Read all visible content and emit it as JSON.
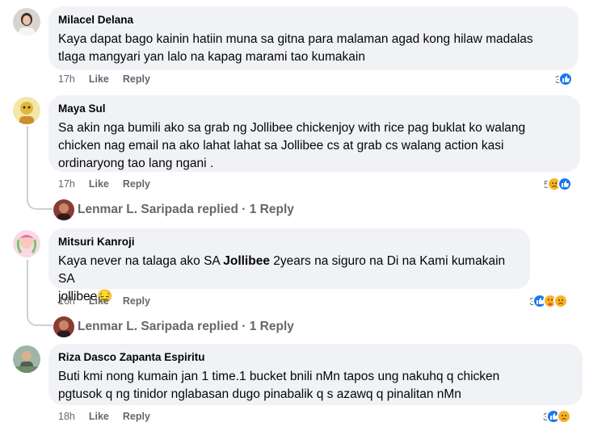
{
  "comments": [
    {
      "author": "Milacel Delana",
      "text": [
        "Kaya dapat bago kainin hatiin muna sa gitna para malaman agad kong hilaw madalas",
        "tlaga mangyari yan lalo na kapag marami tao kumakain"
      ],
      "time": "17h",
      "like_label": "Like",
      "reply_label": "Reply",
      "reaction_count": "3",
      "reaction_icons": [
        "like-icon"
      ]
    },
    {
      "author": "Maya Sul",
      "text": [
        "Sa akin nga bumili ako sa grab ng Jollibee chickenjoy with rice pag buklat ko walang",
        "chicken nag email na ako lahat lahat sa Jollibee cs at grab cs walang action kasi",
        "ordinaryong tao lang ngani ."
      ],
      "time": "17h",
      "like_label": "Like",
      "reply_label": "Reply",
      "reaction_count": "5",
      "reaction_icons": [
        "sad-icon",
        "like-icon"
      ],
      "replies_summary": "Lenmar L. Saripada replied · 1 Reply"
    },
    {
      "author": "Mitsuri Kanroji",
      "text_before": "Kaya never na talaga ako SA ",
      "text_bold": "Jollibee",
      "text_after": " 2years na siguro na Di na Kami kumakain SA",
      "text_line2": "jollibee😔",
      "time": "16h",
      "like_label": "Like",
      "reply_label": "Reply",
      "reaction_count": "3",
      "reaction_icons": [
        "like-icon",
        "care-icon",
        "sad-icon"
      ],
      "replies_summary": "Lenmar L. Saripada replied · 1 Reply"
    },
    {
      "author": "Riza Dasco Zapanta Espiritu",
      "text": [
        "Buti kmi nong kumain jan 1 time.1 bucket bnili nMn tapos ung nakuhq q chicken",
        "pgtusok q ng tinidor nglabasan dugo pinabalik q s azawq q pinalitan nMn"
      ],
      "time": "18h",
      "like_label": "Like",
      "reply_label": "Reply",
      "reaction_count": "3",
      "reaction_icons": [
        "like-icon",
        "sad-icon"
      ]
    }
  ],
  "colors": {
    "bubble": "#f0f2f5",
    "meta": "#65676b",
    "like": "#1877f2",
    "sad": "#f7b125"
  }
}
